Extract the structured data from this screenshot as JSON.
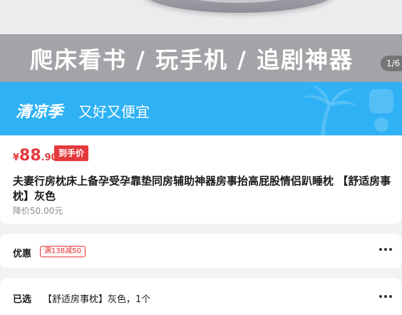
{
  "hero": {
    "headline": "爬床看书 / 玩手机 / 追剧神器",
    "pager": "1/6"
  },
  "promo": {
    "title": "清凉季",
    "subtitle": "又好又便宜"
  },
  "product": {
    "price_symbol": "¥",
    "price_int": "88",
    "price_dec": ".90",
    "price_tag": "到手价",
    "title": "夫妻行房枕床上备孕受孕靠垫同房辅助神器房事抬高屁股情侣趴睡枕 【舒适房事枕】灰色",
    "reduced": "降价50.00元"
  },
  "offer": {
    "label": "优惠",
    "coupon": "满138减50"
  },
  "selected": {
    "label": "已选",
    "value": "【舒适房事枕】灰色，1个"
  },
  "colors": {
    "accent": "#e4393c",
    "promo_bg": "#2fb1f5"
  }
}
